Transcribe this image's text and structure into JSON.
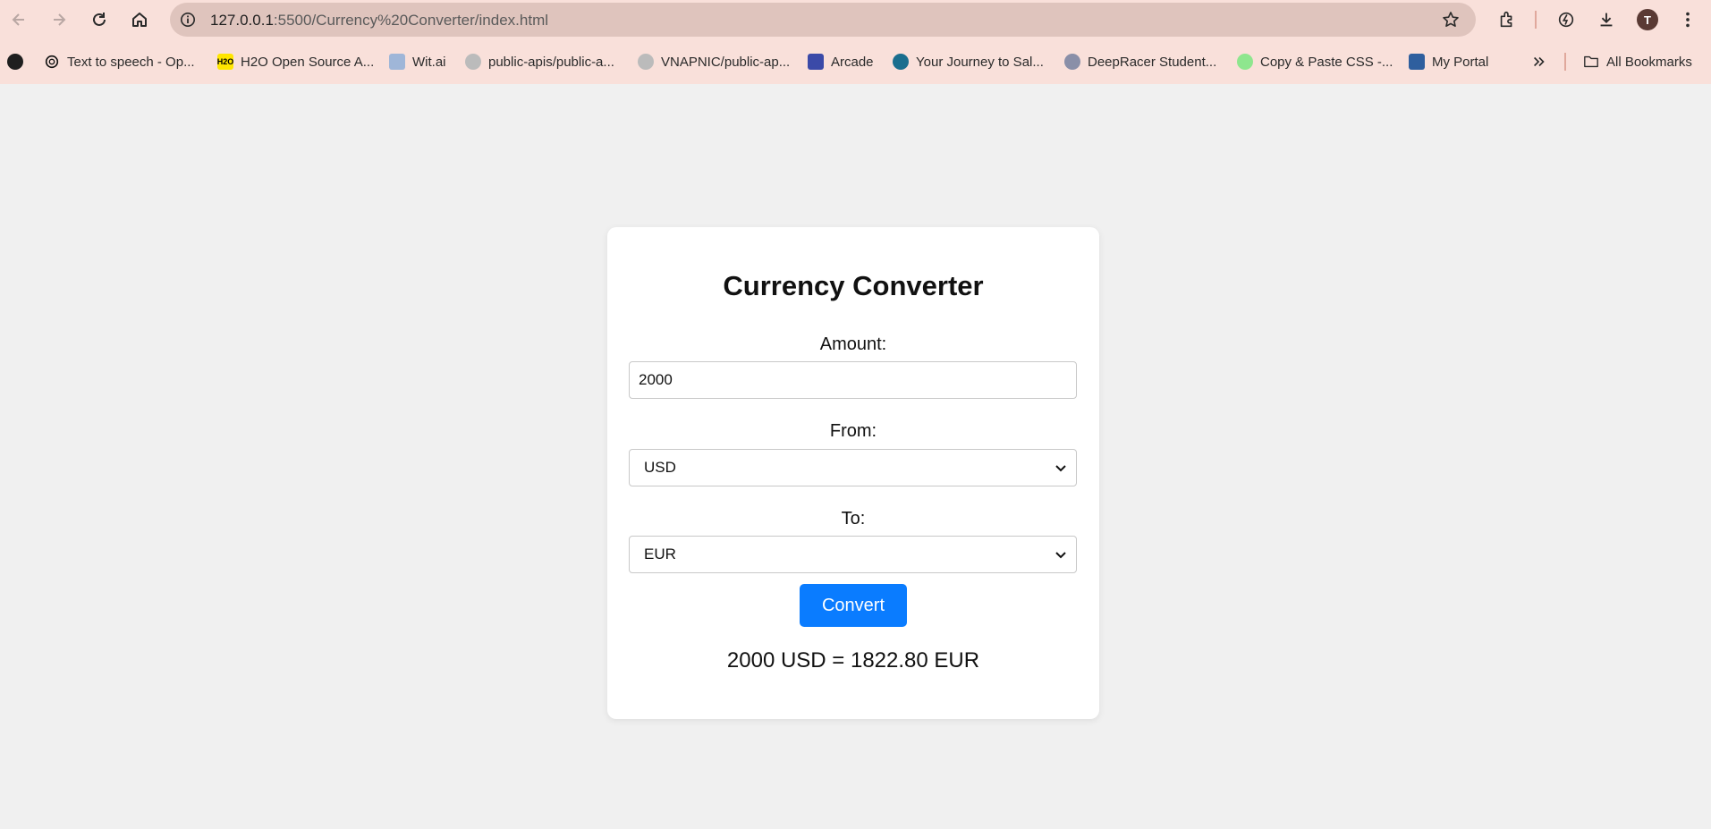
{
  "browser": {
    "url_host": "127.0.0.1",
    "url_path": ":5500/Currency%20Converter/index.html",
    "avatar_letter": "T",
    "bookmarks": [
      {
        "label": "Text to speech - Op...",
        "icon": "openai-icon"
      },
      {
        "label": "H2O Open Source A...",
        "icon": "h2o-icon"
      },
      {
        "label": "Wit.ai",
        "icon": "wit-icon"
      },
      {
        "label": "public-apis/public-a...",
        "icon": "github-icon"
      },
      {
        "label": "VNAPNIC/public-ap...",
        "icon": "github-icon"
      },
      {
        "label": "Arcade",
        "icon": "arcade-icon"
      },
      {
        "label": "Your Journey to Sal...",
        "icon": "trailhead-icon"
      },
      {
        "label": "DeepRacer Student...",
        "icon": "deepracer-icon"
      },
      {
        "label": "Copy & Paste CSS -...",
        "icon": "css-icon"
      },
      {
        "label": "My Portal",
        "icon": "portal-icon"
      }
    ],
    "all_bookmarks_label": "All Bookmarks"
  },
  "app": {
    "title": "Currency Converter",
    "amount_label": "Amount:",
    "amount_value": "2000",
    "from_label": "From:",
    "from_value": "USD",
    "to_label": "To:",
    "to_value": "EUR",
    "convert_label": "Convert",
    "result": "2000 USD = 1822.80 EUR"
  },
  "colors": {
    "chrome_bg": "#f9e0da",
    "page_bg": "#f0f0f0",
    "button": "#0a7cff"
  }
}
